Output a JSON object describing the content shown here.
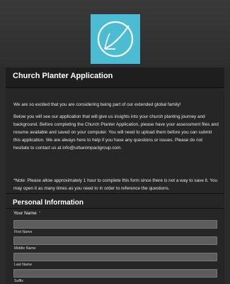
{
  "logo": {
    "name": "church-planter-logo",
    "background": "#4bbcd2"
  },
  "form": {
    "title": "Church Planter Application",
    "intro_p1": "We are so excited that you are considering being part of our extended global family!",
    "intro_p2": "Below you will see our application that will give us insights into your church planting journey and background. Before completing the Church Planter Application, please have your assessment files and resume available and saved on your computer. You will need to upload them before you can submit this application. We are always here to help if you have any questions or issues. Please do not hesitate to contact us at info@urbanimpactgroup.com.",
    "intro_p3": "*Note: Please allow approximately 1 hour to complete this form since there is not a way to save it. You may open it as many times as you need to in order to reference the questions."
  },
  "personal_info": {
    "section_title": "Personal Information",
    "name_label": "Your Name",
    "required_mark": "*",
    "subfields": {
      "first": "First Name",
      "middle": "Middle Name",
      "last": "Last Name",
      "suffix": "Suffix"
    }
  },
  "colors": {
    "page_bg": "#2b2b2b",
    "card_bg": "#262626",
    "header_bg": "#1e1e1e",
    "input_bg": "#5d5d5d",
    "required": "#e05a5a"
  }
}
